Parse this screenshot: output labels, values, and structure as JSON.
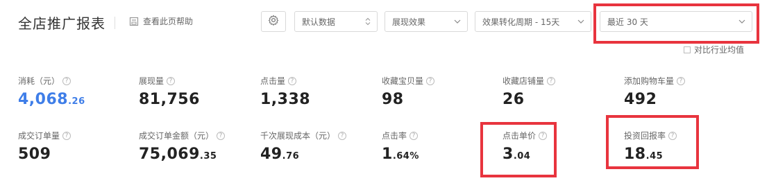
{
  "header": {
    "title": "全店推广报表",
    "help_label": "查看此页帮助"
  },
  "filters": {
    "data_select": "默认数据",
    "effect_select": "展现效果",
    "cycle_select": "效果转化周期 - 15天",
    "range_select": "最近 30 天",
    "compare_label": "对比行业均值"
  },
  "metrics": [
    {
      "label": "消耗（元）",
      "int": "4,068",
      "dec": ".26"
    },
    {
      "label": "展现量",
      "int": "81,756",
      "dec": ""
    },
    {
      "label": "点击量",
      "int": "1,338",
      "dec": ""
    },
    {
      "label": "收藏宝贝量",
      "int": "98",
      "dec": ""
    },
    {
      "label": "收藏店铺量",
      "int": "26",
      "dec": ""
    },
    {
      "label": "添加购物车量",
      "int": "492",
      "dec": ""
    },
    {
      "label": "成交订单量",
      "int": "509",
      "dec": ""
    },
    {
      "label": "成交订单金额（元）",
      "int": "75,069",
      "dec": ".35"
    },
    {
      "label": "千次展现成本（元）",
      "int": "49",
      "dec": ".76"
    },
    {
      "label": "点击率",
      "int": "1",
      "dec": ".64%"
    },
    {
      "label": "点击单价",
      "int": "3",
      "dec": ".04"
    },
    {
      "label": "投资回报率",
      "int": "18",
      "dec": ".45"
    }
  ],
  "colors": {
    "accent_blue": "#3f7ee8",
    "highlight_red": "#e8343e"
  }
}
